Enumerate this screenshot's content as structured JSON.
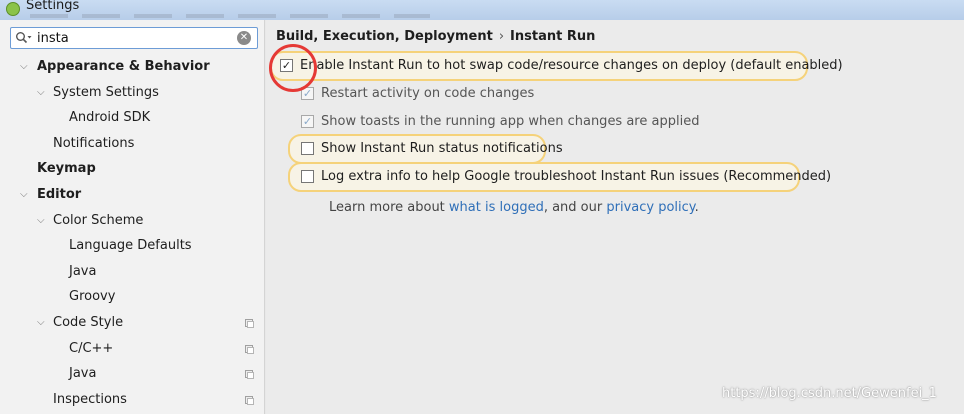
{
  "window": {
    "title": "Settings"
  },
  "search": {
    "value": "insta"
  },
  "tree": [
    {
      "label": "Appearance & Behavior",
      "level": 0,
      "expanded": true,
      "bold": true,
      "copy": false
    },
    {
      "label": "System Settings",
      "level": 1,
      "expanded": true,
      "bold": false,
      "copy": false
    },
    {
      "label": "Android SDK",
      "level": 2,
      "expanded": null,
      "bold": false,
      "copy": false
    },
    {
      "label": "Notifications",
      "level": 1,
      "expanded": null,
      "bold": false,
      "copy": false
    },
    {
      "label": "Keymap",
      "level": 0,
      "expanded": null,
      "bold": true,
      "copy": false
    },
    {
      "label": "Editor",
      "level": 0,
      "expanded": true,
      "bold": true,
      "copy": false
    },
    {
      "label": "Color Scheme",
      "level": 1,
      "expanded": true,
      "bold": false,
      "copy": false
    },
    {
      "label": "Language Defaults",
      "level": 2,
      "expanded": null,
      "bold": false,
      "copy": false
    },
    {
      "label": "Java",
      "level": 2,
      "expanded": null,
      "bold": false,
      "copy": false
    },
    {
      "label": "Groovy",
      "level": 2,
      "expanded": null,
      "bold": false,
      "copy": false
    },
    {
      "label": "Code Style",
      "level": 1,
      "expanded": true,
      "bold": false,
      "copy": true
    },
    {
      "label": "C/C++",
      "level": 2,
      "expanded": null,
      "bold": false,
      "copy": true
    },
    {
      "label": "Java",
      "level": 2,
      "expanded": null,
      "bold": false,
      "copy": true
    },
    {
      "label": "Inspections",
      "level": 1,
      "expanded": null,
      "bold": false,
      "copy": true
    }
  ],
  "breadcrumb": {
    "parent": "Build, Execution, Deployment",
    "separator": "›",
    "current": "Instant Run"
  },
  "options": {
    "enable": {
      "label": "Enable Instant Run to hot swap code/resource changes on deploy (default enabled)",
      "checked": true,
      "enabled": true
    },
    "restart": {
      "label": "Restart activity on code changes",
      "checked": true,
      "enabled": false
    },
    "toasts": {
      "label": "Show toasts in the running app when changes are applied",
      "checked": true,
      "enabled": false
    },
    "status": {
      "label": "Show Instant Run status notifications",
      "checked": false,
      "enabled": true
    },
    "log": {
      "label": "Log extra info to help Google troubleshoot Instant Run issues (Recommended)",
      "checked": false,
      "enabled": true
    }
  },
  "learn": {
    "prefix": "Learn more about ",
    "link1": "what is logged",
    "middle": ", and our ",
    "link2": "privacy policy",
    "suffix": "."
  },
  "watermark": "https://blog.csdn.net/Gewenfei_1",
  "colors": {
    "highlight": "#f5d27a",
    "link": "#2f6fb8",
    "annotation": "#e53935",
    "search_border": "#6d9cd6"
  }
}
